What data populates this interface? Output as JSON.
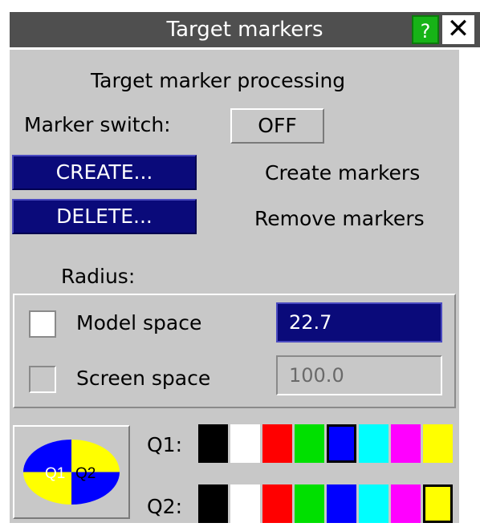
{
  "window": {
    "title": "Target markers",
    "help_label": "?",
    "close_label": "✕"
  },
  "processing": {
    "heading": "Target marker processing",
    "switch_label": "Marker switch:",
    "switch_value": "OFF",
    "create_button": "CREATE...",
    "create_desc": "Create markers",
    "delete_button": "DELETE...",
    "delete_desc": "Remove markers"
  },
  "radius": {
    "label": "Radius:",
    "model_space_label": "Model space",
    "model_space_value": "22.7",
    "model_space_checked": true,
    "screen_space_label": "Screen space",
    "screen_space_value": "100.0",
    "screen_space_checked": false
  },
  "colours": {
    "quad_labels": [
      "Q1",
      "Q2"
    ],
    "q1_label": "Q1:",
    "q2_label": "Q2:",
    "palette": [
      "#000000",
      "#ffffff",
      "#ff0000",
      "#00e000",
      "#0000ff",
      "#00ffff",
      "#ff00ff",
      "#ffff00"
    ],
    "q1_selected_index": 4,
    "q2_selected_index": 7,
    "q1_fill": "#ffff00",
    "q2_fill": "#0000ff"
  }
}
